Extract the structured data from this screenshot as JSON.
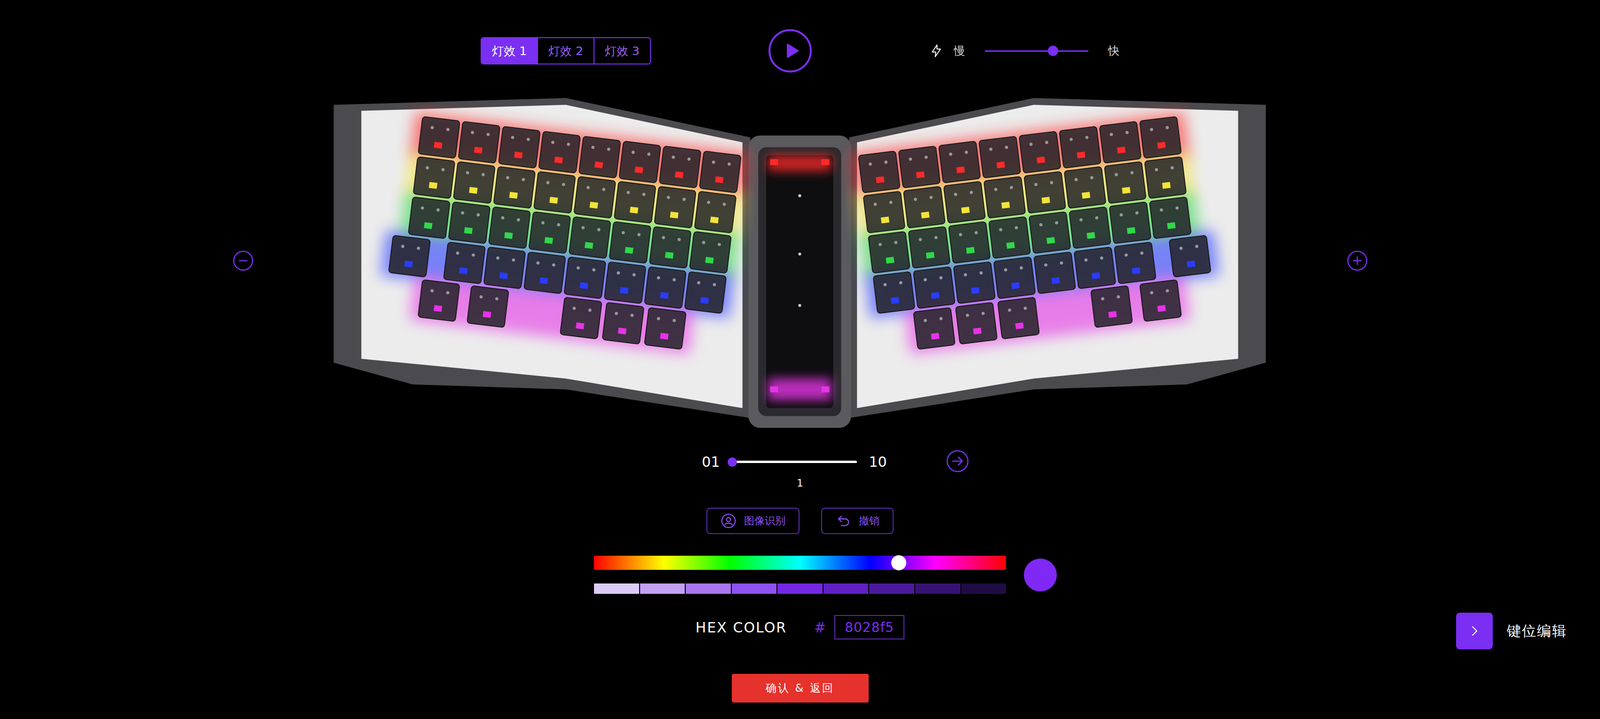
{
  "tabs": [
    {
      "label": "灯效 1",
      "selected": true
    },
    {
      "label": "灯效 2",
      "selected": false
    },
    {
      "label": "灯效 3",
      "selected": false
    }
  ],
  "speed": {
    "slow": "慢",
    "fast": "快",
    "level": 0.66
  },
  "keyboard": {
    "rows": [
      {
        "color": "#ff2a2a"
      },
      {
        "color": "#f3e43a"
      },
      {
        "color": "#2fd84c"
      },
      {
        "color": "#2a3cff"
      },
      {
        "color": "#e534e6"
      }
    ]
  },
  "frames": {
    "start": "01",
    "end": "10",
    "level": 0,
    "current": "1"
  },
  "actions": [
    {
      "label": "图像识别"
    },
    {
      "label": "撤销"
    }
  ],
  "color": {
    "hue_level": 0.74,
    "value": "#8028f5",
    "hex_label": "HEX COLOR",
    "hash": "#",
    "hex": "8028f5",
    "shades": [
      {
        "color": "#dccbf8"
      },
      {
        "color": "#c2a0f3"
      },
      {
        "color": "#a877ef"
      },
      {
        "color": "#8f52f0"
      },
      {
        "color": "#7428e6"
      },
      {
        "color": "#6020c4"
      },
      {
        "color": "#4c1a9c"
      },
      {
        "color": "#361372"
      },
      {
        "color": "#200c44"
      }
    ]
  },
  "confirm": {
    "label": "确认 & 返回"
  },
  "keymap": {
    "label": "键位编辑"
  }
}
